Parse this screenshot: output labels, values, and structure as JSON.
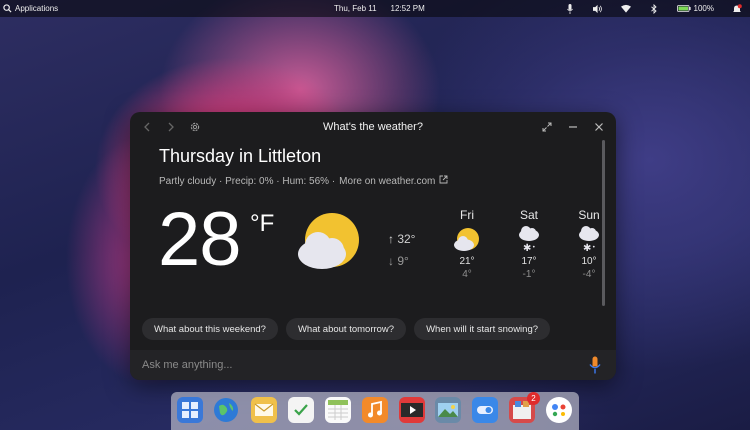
{
  "panel": {
    "applications_label": "Applications",
    "date": "Thu, Feb 11",
    "time": "12:52 PM",
    "battery": "100%"
  },
  "assistant": {
    "title": "What's the weather?",
    "weather": {
      "heading": "Thursday in Littleton",
      "summary": "Partly cloudy · Precip: 0% · Hum: 56% ·",
      "more_link": "More on weather.com",
      "temperature": "28",
      "unit": "°F",
      "high": "↑ 32°",
      "low": "↓ 9°",
      "forecast": [
        {
          "day": "Fri",
          "high": "21°",
          "low": "4°",
          "icon": "partly-cloudy"
        },
        {
          "day": "Sat",
          "high": "17°",
          "low": "-1°",
          "icon": "snow"
        },
        {
          "day": "Sun",
          "high": "10°",
          "low": "-4°",
          "icon": "snow"
        }
      ]
    },
    "suggestions": [
      "What about this weekend?",
      "What about tomorrow?",
      "When will it start snowing?"
    ],
    "input_placeholder": "Ask me anything..."
  },
  "dock": {
    "badge_count": "2"
  },
  "colors": {
    "sun": "#F2C230",
    "cloud": "#E6E6EE",
    "mic_orange": "#F08A2C",
    "mic_blue": "#3D7BF2",
    "window_bg": "#1C1C1E"
  }
}
